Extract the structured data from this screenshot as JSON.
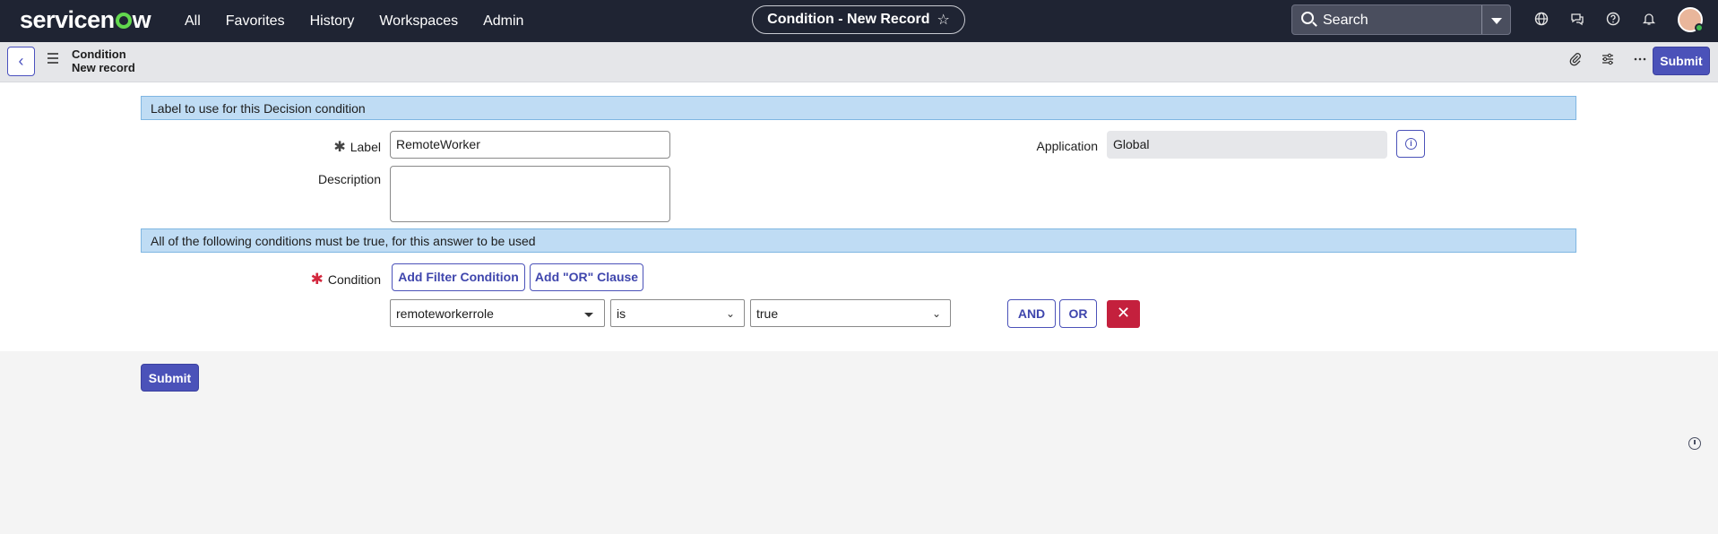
{
  "app": {
    "logo_text_a": "servicen",
    "logo_text_b": "w",
    "nav": [
      "All",
      "Favorites",
      "History",
      "Workspaces",
      "Admin"
    ],
    "page_title": "Condition - New Record",
    "search_label": "Search"
  },
  "record": {
    "table": "Condition",
    "subtitle": "New record",
    "submit_label": "Submit"
  },
  "form": {
    "section1_title": "Label to use for this Decision condition",
    "label_field": {
      "label": "Label",
      "value": "RemoteWorker"
    },
    "description_field": {
      "label": "Description",
      "value": ""
    },
    "application_field": {
      "label": "Application",
      "value": "Global"
    },
    "section2_title": "All of the following conditions must be true, for this answer to be used",
    "condition_label": "Condition",
    "add_filter_label": "Add Filter Condition",
    "add_or_label": "Add \"OR\" Clause",
    "condition_row": {
      "field": "remoteworkerrole",
      "operator": "is",
      "value": "true",
      "and_label": "AND",
      "or_label": "OR"
    }
  },
  "icons": {
    "star": "☆",
    "back": "‹",
    "close": "✕"
  }
}
